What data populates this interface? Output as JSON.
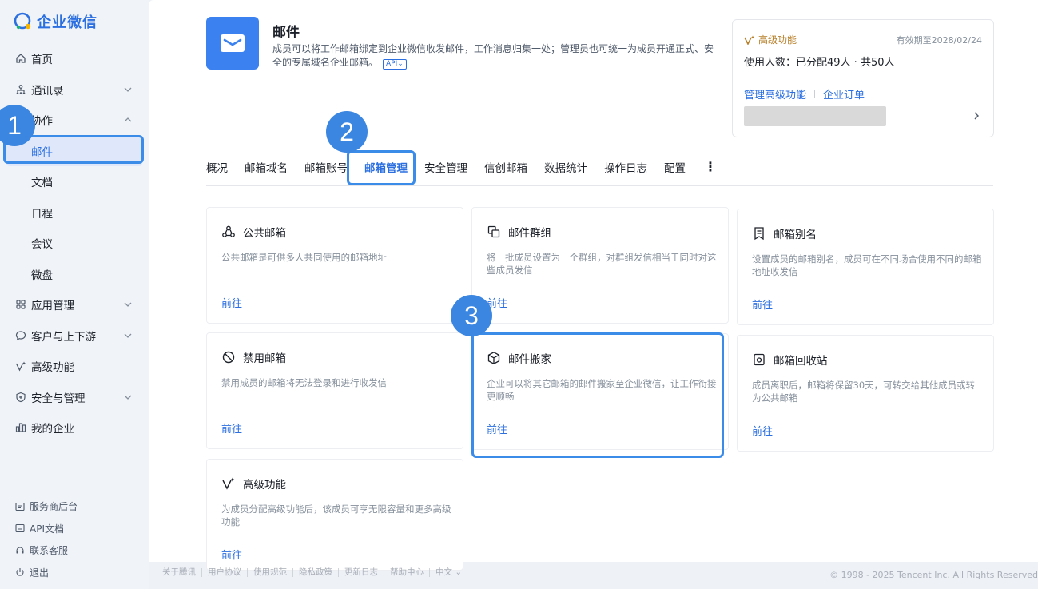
{
  "brand": {
    "name": "企业微信"
  },
  "sidebar": {
    "items": [
      {
        "label": "首页"
      },
      {
        "label": "通讯录"
      },
      {
        "label": "协作"
      },
      {
        "label": "邮件"
      },
      {
        "label": "文档"
      },
      {
        "label": "日程"
      },
      {
        "label": "会议"
      },
      {
        "label": "微盘"
      },
      {
        "label": "应用管理"
      },
      {
        "label": "客户与上下游"
      },
      {
        "label": "高级功能"
      },
      {
        "label": "安全与管理"
      },
      {
        "label": "我的企业"
      }
    ],
    "bottom": [
      {
        "label": "服务商后台"
      },
      {
        "label": "API文档"
      },
      {
        "label": "联系客服"
      },
      {
        "label": "退出"
      }
    ]
  },
  "hero": {
    "title": "邮件",
    "desc": "成员可以将工作邮箱绑定到企业微信收发邮件，工作消息归集一处；管理员也可统一为成员开通正式、安全的专属域名企业邮箱。",
    "api": "API"
  },
  "advanced": {
    "title": "高级功能",
    "expire": "有效期至2028/02/24",
    "count": "使用人数：已分配49人 · 共50人",
    "link_manage": "管理高级功能",
    "link_orders": "企业订单"
  },
  "tabs": [
    {
      "label": "概况"
    },
    {
      "label": "邮箱域名"
    },
    {
      "label": "邮箱账号"
    },
    {
      "label": "邮箱管理"
    },
    {
      "label": "安全管理"
    },
    {
      "label": "信创邮箱"
    },
    {
      "label": "数据统计"
    },
    {
      "label": "操作日志"
    },
    {
      "label": "配置"
    }
  ],
  "tabs_more": "⋮",
  "cards": [
    {
      "title": "公共邮箱",
      "desc": "公共邮箱是可供多人共同使用的邮箱地址",
      "link": "前往"
    },
    {
      "title": "邮件群组",
      "desc": "将一批成员设置为一个群组，对群组发信相当于同时对这些成员发信",
      "link": "前往"
    },
    {
      "title": "邮箱别名",
      "desc": "设置成员的邮箱别名，成员可在不同场合使用不同的邮箱地址收发信",
      "link": "前往"
    },
    {
      "title": "禁用邮箱",
      "desc": "禁用成员的邮箱将无法登录和进行收发信",
      "link": "前往"
    },
    {
      "title": "邮件搬家",
      "desc": "企业可以将其它邮箱的邮件搬家至企业微信，让工作衔接更顺畅",
      "link": "前往"
    },
    {
      "title": "邮箱回收站",
      "desc": "成员离职后，邮箱将保留30天，可转交给其他成员或转为公共邮箱",
      "link": "前往"
    },
    {
      "title": "高级功能",
      "desc": "为成员分配高级功能后，该成员可享无限容量和更多高级功能",
      "link": "前往"
    }
  ],
  "badges": {
    "one": "1",
    "two": "2",
    "three": "3"
  },
  "footer": {
    "links": [
      {
        "label": "关于腾讯"
      },
      {
        "label": "用户协议"
      },
      {
        "label": "使用规范"
      },
      {
        "label": "隐私政策"
      },
      {
        "label": "更新日志"
      },
      {
        "label": "帮助中心"
      },
      {
        "label": "中文 ⌄"
      }
    ],
    "copyright": "© 1998 - 2025 Tencent Inc. All Rights Reserved"
  },
  "colors": {
    "accent": "#2b6fe0",
    "highlight": "#3b8be8",
    "badge": "#3a86e0",
    "gold": "#b7802b"
  }
}
